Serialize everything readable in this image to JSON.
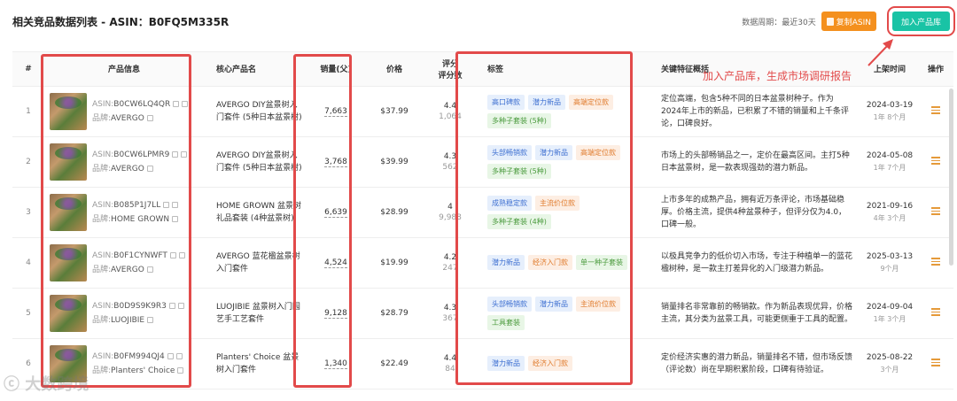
{
  "header": {
    "title": "相关竞品数据列表 - ASIN：B0FQ5M335R",
    "period": "数据周期：最近30天",
    "copy_label": "复制ASIN",
    "add_label": "加入产品库"
  },
  "annotation": "加入产品库，生成市场调研报告",
  "watermark": "ⓒ 大数跨境",
  "columns": {
    "idx": "#",
    "product": "产品信息",
    "core": "核心产品名",
    "sales": "销量(父)",
    "price": "价格",
    "rating1": "评分",
    "rating2": "评分数",
    "tags": "标签",
    "feature": "关键特征概括",
    "date": "上架时间",
    "op": "操作"
  },
  "labels": {
    "asin": "ASIN:",
    "brand": "品牌:"
  },
  "rows": [
    {
      "idx": "1",
      "asin": "B0CW6LQ4QR",
      "brand": "AVERGO",
      "core": "AVERGO DIY盆景树入门套件 (5种日本盆景树)",
      "sales": "7,663",
      "price": "$37.99",
      "rating": "4.4",
      "rating_count": "1,064",
      "tags": [
        {
          "text": "高口碑款",
          "color": "blue"
        },
        {
          "text": "潜力新品",
          "color": "blue"
        },
        {
          "text": "高端定位款",
          "color": "orange"
        },
        {
          "text": "多种子套装 (5种)",
          "color": "green"
        }
      ],
      "feature": "定位高端，包含5种不同的日本盆景树种子。作为2024年上市的新品，已积累了不错的销量和上千条评论，口碑良好。",
      "date": "2024-03-19",
      "ago": "1年 8个月"
    },
    {
      "idx": "2",
      "asin": "B0CW6LPMR9",
      "brand": "AVERGO",
      "core": "AVERGO DIY盆景树入门套件 (5种日本盆景树)",
      "sales": "3,768",
      "price": "$39.99",
      "rating": "4.3",
      "rating_count": "562",
      "tags": [
        {
          "text": "头部畅销款",
          "color": "blue"
        },
        {
          "text": "潜力新品",
          "color": "blue"
        },
        {
          "text": "高端定位款",
          "color": "orange"
        },
        {
          "text": "多种子套装 (5种)",
          "color": "green"
        }
      ],
      "feature": "市场上的头部畅销品之一，定价在最高区间。主打5种日本盆景树，是一款表现强劲的潜力新品。",
      "date": "2024-05-08",
      "ago": "1年 7个月"
    },
    {
      "idx": "3",
      "asin": "B085P1J7LL",
      "brand": "HOME GROWN",
      "core": "HOME GROWN 盆景树礼品套装 (4种盆景树)",
      "sales": "6,639",
      "price": "$28.99",
      "rating": "4",
      "rating_count": "9,988",
      "tags": [
        {
          "text": "成熟稳定款",
          "color": "blue"
        },
        {
          "text": "主流价位款",
          "color": "orange"
        },
        {
          "text": "多种子套装 (4种)",
          "color": "green"
        }
      ],
      "feature": "上市多年的成熟产品，拥有近万条评论，市场基础稳厚。价格主流，提供4种盆景种子，但评分仅为4.0，口碑一般。",
      "date": "2021-09-16",
      "ago": "4年 3个月"
    },
    {
      "idx": "4",
      "asin": "B0F1CYNWFT",
      "brand": "AVERGO",
      "core": "AVERGO 蓝花楹盆景树入门套件",
      "sales": "4,524",
      "price": "$19.99",
      "rating": "4.2",
      "rating_count": "247",
      "tags": [
        {
          "text": "潜力新品",
          "color": "blue"
        },
        {
          "text": "经济入门款",
          "color": "orange"
        },
        {
          "text": "单一种子套装",
          "color": "green"
        }
      ],
      "feature": "以极具竞争力的低价切入市场，专注于种植单一的蓝花楹树种，是一款主打差异化的入门级潜力新品。",
      "date": "2025-03-13",
      "ago": "9个月"
    },
    {
      "idx": "5",
      "asin": "B0D9S9K9R3",
      "brand": "LUOJIBIE",
      "core": "LUOJIBIE 盆景树入门园艺手工艺套件",
      "sales": "9,128",
      "price": "$28.79",
      "rating": "4.3",
      "rating_count": "367",
      "tags": [
        {
          "text": "头部畅销款",
          "color": "blue"
        },
        {
          "text": "潜力新品",
          "color": "blue"
        },
        {
          "text": "主流价位款",
          "color": "orange"
        },
        {
          "text": "工具套装",
          "color": "green"
        }
      ],
      "feature": "销量排名非常靠前的畅销款。作为新品表现优异，价格主流，其分类为盆景工具，可能更侧重于工具的配置。",
      "date": "2024-09-04",
      "ago": "1年 3个月"
    },
    {
      "idx": "6",
      "asin": "B0FM994QJ4",
      "brand": "Planters' Choice",
      "core": "Planters' Choice 盆景树入门套件",
      "sales": "1,340",
      "price": "$22.49",
      "rating": "4.4",
      "rating_count": "84",
      "tags": [
        {
          "text": "潜力新品",
          "color": "blue"
        },
        {
          "text": "经济入门款",
          "color": "orange"
        }
      ],
      "feature": "定价经济实惠的潜力新品，销量排名不错，但市场反馈（评论数）尚在早期积累阶段，口碑有待验证。",
      "date": "2025-08-22",
      "ago": "3个月"
    }
  ],
  "colors": {
    "accent": "#19c3a5",
    "copy": "#f4901e",
    "highlight": "#e24a4a"
  }
}
